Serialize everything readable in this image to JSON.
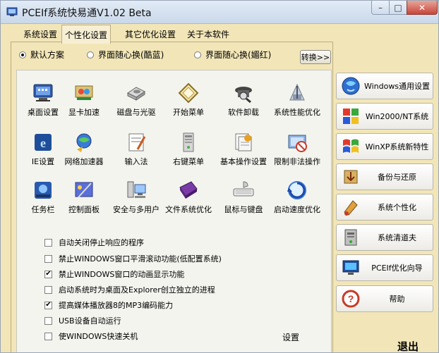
{
  "window": {
    "title": "PCEIf系统快易通V1.02 Beta",
    "controls": {
      "minimize": "–",
      "maximize": "□",
      "close": "✕"
    }
  },
  "tabs": [
    "系统设置",
    "个性化设置",
    "其它优化设置",
    "关于本软件"
  ],
  "active_tab": 1,
  "radios": [
    "默认方案",
    "界面随心换(酷蓝)",
    "界面随心换(媚红)"
  ],
  "selected_radio": 0,
  "switch_label": "转换>>",
  "grid": [
    {
      "label": "桌面设置",
      "icon": "desktop-icon"
    },
    {
      "label": "显卡加速",
      "icon": "display-card-icon"
    },
    {
      "label": "磁盘与光驱",
      "icon": "disk-drive-icon"
    },
    {
      "label": "开始菜单",
      "icon": "start-menu-icon"
    },
    {
      "label": "软件卸载",
      "icon": "uninstall-icon"
    },
    {
      "label": "系统性能优化",
      "icon": "performance-icon"
    },
    {
      "label": "IE设置",
      "icon": "ie-icon"
    },
    {
      "label": "网络加速器",
      "icon": "network-icon"
    },
    {
      "label": "输入法",
      "icon": "input-method-icon"
    },
    {
      "label": "右键菜单",
      "icon": "context-menu-icon"
    },
    {
      "label": "基本操作设置",
      "icon": "basic-ops-icon"
    },
    {
      "label": "限制非法操作",
      "icon": "restrict-icon"
    },
    {
      "label": "任务栏",
      "icon": "taskbar-icon"
    },
    {
      "label": "控制面板",
      "icon": "control-panel-icon"
    },
    {
      "label": "安全与多用户",
      "icon": "security-users-icon"
    },
    {
      "label": "文件系统优化",
      "icon": "filesystem-icon"
    },
    {
      "label": "鼠标与键盘",
      "icon": "mouse-keyboard-icon"
    },
    {
      "label": "启动速度优化",
      "icon": "startup-speed-icon"
    }
  ],
  "options": [
    {
      "label": "自动关闭停止响应的程序",
      "checked": false
    },
    {
      "label": "禁止WINDOWS窗口平滑滚动功能(低配置系统)",
      "checked": false
    },
    {
      "label": "禁止WINDOWS窗口的动画显示功能",
      "checked": true
    },
    {
      "label": "启动系统时为桌面及Explorer创立独立的进程",
      "checked": false
    },
    {
      "label": "提高媒体播放器8的MP3编码能力",
      "checked": true
    },
    {
      "label": "USB设备自动运行",
      "checked": false
    },
    {
      "label": "使WINDOWS快速关机",
      "checked": false
    }
  ],
  "setup_label": "设置",
  "sidebar": [
    {
      "label": "Windows通用设置",
      "icon": "globe-icon"
    },
    {
      "label": "Win2000/NT系统",
      "icon": "windows-nt-icon"
    },
    {
      "label": "WinXP系统新特性",
      "icon": "windows-xp-icon"
    },
    {
      "label": "备份与还原",
      "icon": "backup-icon"
    },
    {
      "label": "系统个性化",
      "icon": "personalize-icon"
    },
    {
      "label": "系统清道夫",
      "icon": "cleaner-icon"
    },
    {
      "label": "PCEIf优化向导",
      "icon": "wizard-icon"
    },
    {
      "label": "帮助",
      "icon": "help-icon"
    }
  ],
  "exit_label": "退出"
}
